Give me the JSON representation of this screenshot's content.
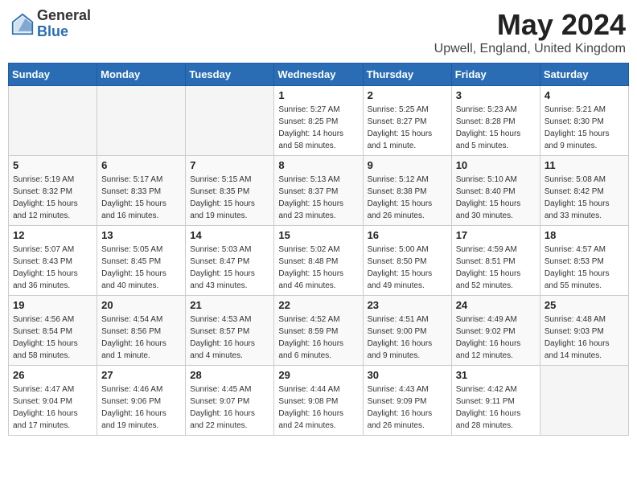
{
  "header": {
    "logo_general": "General",
    "logo_blue": "Blue",
    "month_title": "May 2024",
    "location": "Upwell, England, United Kingdom"
  },
  "days_of_week": [
    "Sunday",
    "Monday",
    "Tuesday",
    "Wednesday",
    "Thursday",
    "Friday",
    "Saturday"
  ],
  "weeks": [
    [
      {
        "day": "",
        "info": ""
      },
      {
        "day": "",
        "info": ""
      },
      {
        "day": "",
        "info": ""
      },
      {
        "day": "1",
        "info": "Sunrise: 5:27 AM\nSunset: 8:25 PM\nDaylight: 14 hours\nand 58 minutes."
      },
      {
        "day": "2",
        "info": "Sunrise: 5:25 AM\nSunset: 8:27 PM\nDaylight: 15 hours\nand 1 minute."
      },
      {
        "day": "3",
        "info": "Sunrise: 5:23 AM\nSunset: 8:28 PM\nDaylight: 15 hours\nand 5 minutes."
      },
      {
        "day": "4",
        "info": "Sunrise: 5:21 AM\nSunset: 8:30 PM\nDaylight: 15 hours\nand 9 minutes."
      }
    ],
    [
      {
        "day": "5",
        "info": "Sunrise: 5:19 AM\nSunset: 8:32 PM\nDaylight: 15 hours\nand 12 minutes."
      },
      {
        "day": "6",
        "info": "Sunrise: 5:17 AM\nSunset: 8:33 PM\nDaylight: 15 hours\nand 16 minutes."
      },
      {
        "day": "7",
        "info": "Sunrise: 5:15 AM\nSunset: 8:35 PM\nDaylight: 15 hours\nand 19 minutes."
      },
      {
        "day": "8",
        "info": "Sunrise: 5:13 AM\nSunset: 8:37 PM\nDaylight: 15 hours\nand 23 minutes."
      },
      {
        "day": "9",
        "info": "Sunrise: 5:12 AM\nSunset: 8:38 PM\nDaylight: 15 hours\nand 26 minutes."
      },
      {
        "day": "10",
        "info": "Sunrise: 5:10 AM\nSunset: 8:40 PM\nDaylight: 15 hours\nand 30 minutes."
      },
      {
        "day": "11",
        "info": "Sunrise: 5:08 AM\nSunset: 8:42 PM\nDaylight: 15 hours\nand 33 minutes."
      }
    ],
    [
      {
        "day": "12",
        "info": "Sunrise: 5:07 AM\nSunset: 8:43 PM\nDaylight: 15 hours\nand 36 minutes."
      },
      {
        "day": "13",
        "info": "Sunrise: 5:05 AM\nSunset: 8:45 PM\nDaylight: 15 hours\nand 40 minutes."
      },
      {
        "day": "14",
        "info": "Sunrise: 5:03 AM\nSunset: 8:47 PM\nDaylight: 15 hours\nand 43 minutes."
      },
      {
        "day": "15",
        "info": "Sunrise: 5:02 AM\nSunset: 8:48 PM\nDaylight: 15 hours\nand 46 minutes."
      },
      {
        "day": "16",
        "info": "Sunrise: 5:00 AM\nSunset: 8:50 PM\nDaylight: 15 hours\nand 49 minutes."
      },
      {
        "day": "17",
        "info": "Sunrise: 4:59 AM\nSunset: 8:51 PM\nDaylight: 15 hours\nand 52 minutes."
      },
      {
        "day": "18",
        "info": "Sunrise: 4:57 AM\nSunset: 8:53 PM\nDaylight: 15 hours\nand 55 minutes."
      }
    ],
    [
      {
        "day": "19",
        "info": "Sunrise: 4:56 AM\nSunset: 8:54 PM\nDaylight: 15 hours\nand 58 minutes."
      },
      {
        "day": "20",
        "info": "Sunrise: 4:54 AM\nSunset: 8:56 PM\nDaylight: 16 hours\nand 1 minute."
      },
      {
        "day": "21",
        "info": "Sunrise: 4:53 AM\nSunset: 8:57 PM\nDaylight: 16 hours\nand 4 minutes."
      },
      {
        "day": "22",
        "info": "Sunrise: 4:52 AM\nSunset: 8:59 PM\nDaylight: 16 hours\nand 6 minutes."
      },
      {
        "day": "23",
        "info": "Sunrise: 4:51 AM\nSunset: 9:00 PM\nDaylight: 16 hours\nand 9 minutes."
      },
      {
        "day": "24",
        "info": "Sunrise: 4:49 AM\nSunset: 9:02 PM\nDaylight: 16 hours\nand 12 minutes."
      },
      {
        "day": "25",
        "info": "Sunrise: 4:48 AM\nSunset: 9:03 PM\nDaylight: 16 hours\nand 14 minutes."
      }
    ],
    [
      {
        "day": "26",
        "info": "Sunrise: 4:47 AM\nSunset: 9:04 PM\nDaylight: 16 hours\nand 17 minutes."
      },
      {
        "day": "27",
        "info": "Sunrise: 4:46 AM\nSunset: 9:06 PM\nDaylight: 16 hours\nand 19 minutes."
      },
      {
        "day": "28",
        "info": "Sunrise: 4:45 AM\nSunset: 9:07 PM\nDaylight: 16 hours\nand 22 minutes."
      },
      {
        "day": "29",
        "info": "Sunrise: 4:44 AM\nSunset: 9:08 PM\nDaylight: 16 hours\nand 24 minutes."
      },
      {
        "day": "30",
        "info": "Sunrise: 4:43 AM\nSunset: 9:09 PM\nDaylight: 16 hours\nand 26 minutes."
      },
      {
        "day": "31",
        "info": "Sunrise: 4:42 AM\nSunset: 9:11 PM\nDaylight: 16 hours\nand 28 minutes."
      },
      {
        "day": "",
        "info": ""
      }
    ]
  ]
}
